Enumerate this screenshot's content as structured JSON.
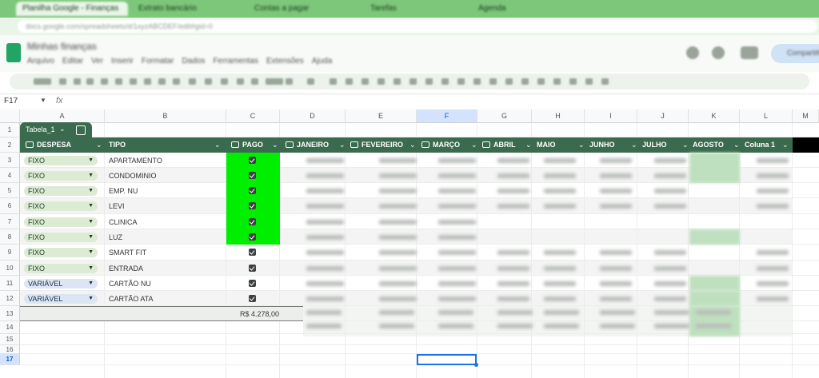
{
  "browser": {
    "tabs": [
      "Planilha Google - Finanças",
      "Extrato bancário",
      "Contas a pagar",
      "Tarefas",
      "Agenda"
    ],
    "url": "docs.google.com/spreadsheets/d/1xyzABCDEF/edit#gid=0"
  },
  "app": {
    "doc_title": "Minhas finanças",
    "menu": [
      "Arquivo",
      "Editar",
      "Ver",
      "Inserir",
      "Formatar",
      "Dados",
      "Ferramentas",
      "Extensões",
      "Ajuda"
    ],
    "share_label": "Compartilhar"
  },
  "formula_bar": {
    "name_box": "F17",
    "fx": "fx",
    "value": ""
  },
  "columns": [
    "A",
    "B",
    "C",
    "D",
    "E",
    "F",
    "G",
    "H",
    "I",
    "J",
    "K",
    "L",
    "M"
  ],
  "selected_column": "F",
  "rows": [
    "1",
    "2",
    "3",
    "4",
    "5",
    "6",
    "7",
    "8",
    "9",
    "10",
    "11",
    "12",
    "13",
    "14",
    "15",
    "16",
    "17"
  ],
  "selected_row": "17",
  "table": {
    "name": "Tabela_1",
    "headers": [
      "DESPESA",
      "TIPO",
      "PAGO",
      "JANEIRO",
      "FEVEREIRO",
      "MARÇO",
      "ABRIL",
      "MAIO",
      "JUNHO",
      "JULHO",
      "AGOSTO",
      "Coluna 1"
    ],
    "records": [
      {
        "despesa": "FIXO",
        "tipo": "APARTAMENTO",
        "pago": true
      },
      {
        "despesa": "FIXO",
        "tipo": "CONDOMINIO",
        "pago": true
      },
      {
        "despesa": "FIXO",
        "tipo": "EMP. NU",
        "pago": true
      },
      {
        "despesa": "FIXO",
        "tipo": "LEVI",
        "pago": true
      },
      {
        "despesa": "FIXO",
        "tipo": "CLINICA",
        "pago": true
      },
      {
        "despesa": "FIXO",
        "tipo": "LUZ",
        "pago": true
      },
      {
        "despesa": "FIXO",
        "tipo": "SMART FIT",
        "pago": true
      },
      {
        "despesa": "FIXO",
        "tipo": "ENTRADA",
        "pago": true
      },
      {
        "despesa": "VARIÁVEL",
        "tipo": "CARTÃO NU",
        "pago": true
      },
      {
        "despesa": "VARIÁVEL",
        "tipo": "CARTÃO ATA",
        "pago": true
      }
    ],
    "total": "R$ 4.278,00"
  },
  "colors": {
    "table_header": "#3b6b4e",
    "paid_highlight": "#00ee00",
    "selection": "#1a73e8"
  }
}
